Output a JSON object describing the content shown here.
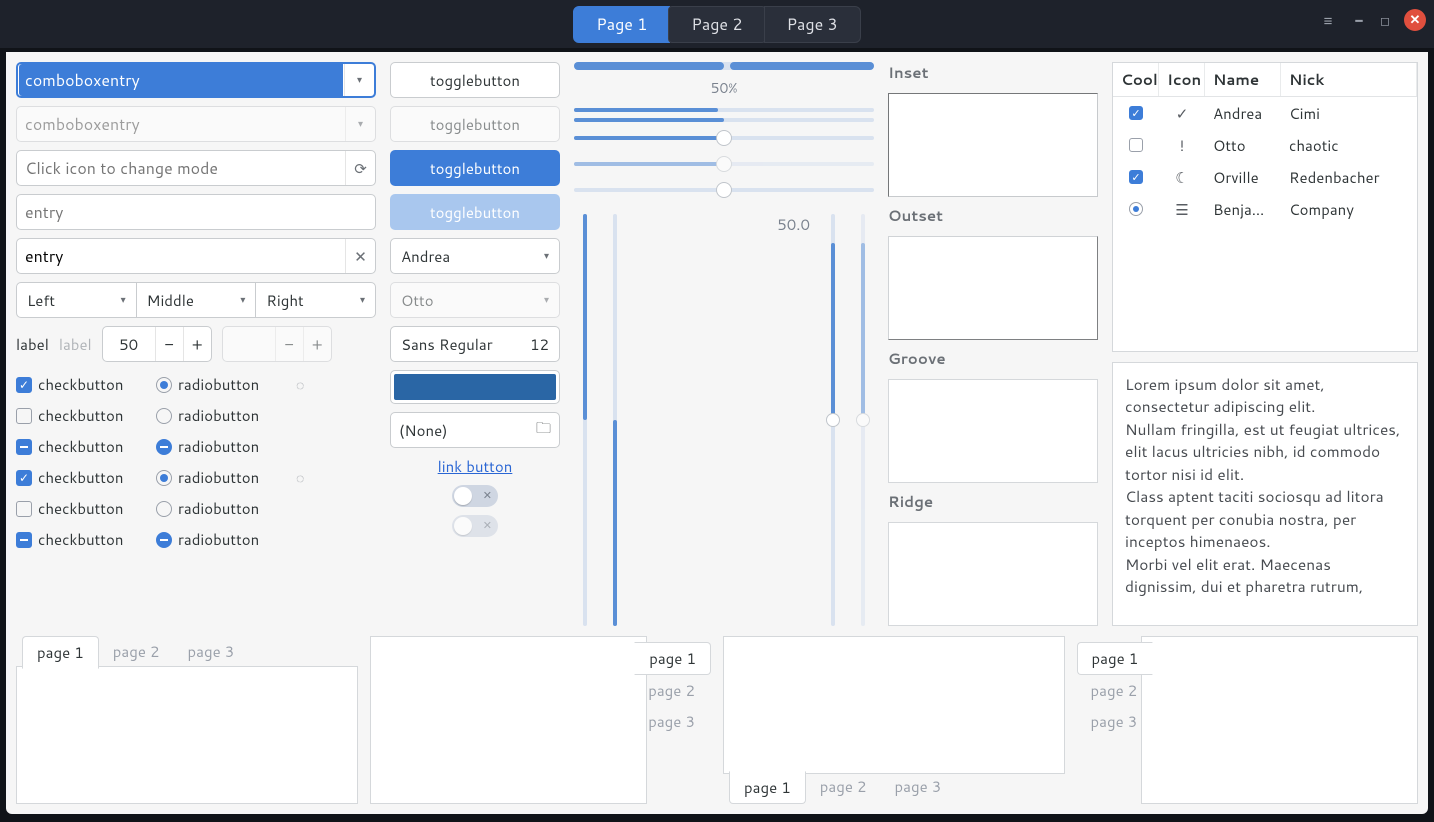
{
  "header": {
    "pages": [
      "Page 1",
      "Page 2",
      "Page 3"
    ],
    "active_page": 0
  },
  "col1": {
    "combo_focused": "comboboxentry",
    "combo_disabled": "comboboxentry",
    "mode_entry_placeholder": "Click icon to change mode",
    "entry1_placeholder": "entry",
    "entry2_value": "entry",
    "position": {
      "left": "Left",
      "middle": "Middle",
      "right": "Right"
    },
    "label1": "label",
    "label2": "label",
    "spin1_value": "50",
    "spin2_value": "",
    "check_label": "checkbutton",
    "radio_label": "radiobutton"
  },
  "col2": {
    "togglebutton": "togglebutton",
    "dropdown1": "Andrea",
    "dropdown2": "Otto",
    "font_name": "Sans Regular",
    "font_size": "12",
    "color": "#2a66a5",
    "file_label": "(None)",
    "link_label": "link button"
  },
  "col3": {
    "progress_label": "50%",
    "progress_value": 50,
    "vslider_label": "50.0"
  },
  "col4": {
    "inset": "Inset",
    "outset": "Outset",
    "groove": "Groove",
    "ridge": "Ridge"
  },
  "tree": {
    "headers": {
      "cool": "Cool",
      "icon": "Icon",
      "name": "Name",
      "nick": "Nick"
    },
    "rows": [
      {
        "checked": true,
        "radio": false,
        "icon": "✓",
        "name": "Andrea",
        "nick": "Cimi"
      },
      {
        "checked": false,
        "radio": false,
        "icon": "!",
        "name": "Otto",
        "nick": "chaotic"
      },
      {
        "checked": true,
        "radio": false,
        "icon": "☾",
        "name": "Orville",
        "nick": "Redenbacher"
      },
      {
        "checked": false,
        "radio": true,
        "icon": "☰",
        "name": "Benja…",
        "nick": "Company"
      }
    ]
  },
  "lorem": "Lorem ipsum dolor sit amet, consectetur adipiscing elit.\nNullam fringilla, est ut feugiat ultrices, elit lacus ultricies nibh, id commodo tortor nisi id elit.\nClass aptent taciti sociosqu ad litora torquent per conubia nostra, per inceptos himenaeos.\nMorbi vel elit erat. Maecenas dignissim, dui et pharetra rutrum,",
  "notebook_tabs": [
    "page 1",
    "page 2",
    "page 3"
  ]
}
